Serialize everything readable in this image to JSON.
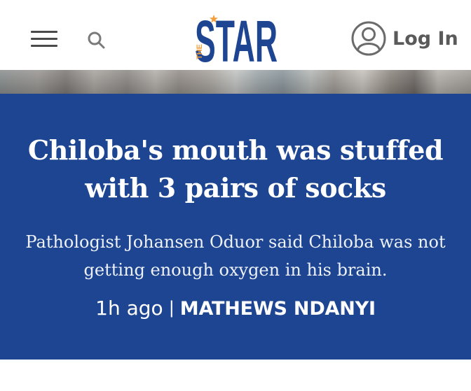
{
  "header": {
    "logo": {
      "small_text": "THE",
      "main_text": "STAR",
      "brand_color": "#1d4591",
      "accent_color": "#f2a03d"
    },
    "menu_icon": "hamburger-menu-icon",
    "search_icon": "search-icon",
    "login": {
      "icon": "user-avatar-icon",
      "label": "Log In"
    }
  },
  "article": {
    "headline": "Chiloba's mouth was stuffed with 3 pairs of socks",
    "summary": "Pathologist Johansen Oduor said Chiloba was not getting enough oxygen in his brain.",
    "time_ago": "1h ago",
    "separator": "|",
    "author": "MATHEWS NDANYI",
    "background_color": "#1d4591"
  }
}
